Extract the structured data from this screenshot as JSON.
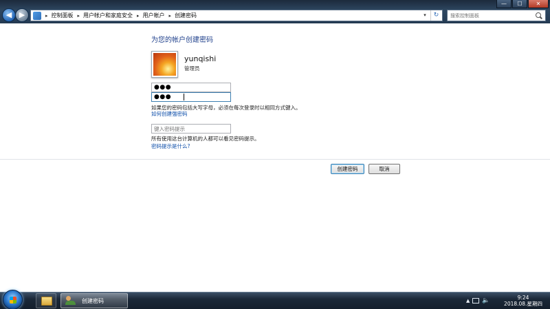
{
  "window": {
    "minimize_glyph": "—",
    "maximize_glyph": "☐",
    "close_glyph": "✕"
  },
  "nav": {
    "back_glyph": "◀",
    "forward_glyph": "▶"
  },
  "address_bar": {
    "separator": "▸",
    "breadcrumb": [
      "控制面板",
      "用户帐户和家庭安全",
      "用户帐户",
      "创建密码"
    ],
    "dropdown_glyph": "▾",
    "refresh_glyph": "↻"
  },
  "search": {
    "placeholder": "搜索控制面板"
  },
  "content": {
    "title": "为您的帐户创建密码",
    "user": {
      "name": "yunqishi",
      "role": "管理员"
    },
    "password_masked": "●●●",
    "confirm_masked": "●●●",
    "caps_warning": "如果您的密码包括大写字母，必须在每次登录时以相同方式键入。",
    "link_strong_password": "如何创建强密码",
    "hint_placeholder": "键入密码提示",
    "hint_warning": "所有使用这台计算机的人都可以看见密码提示。",
    "link_what_hint": "密码提示是什么?",
    "button_create": "创建密码",
    "button_cancel": "取消"
  },
  "taskbar": {
    "active_task": "创建密码",
    "tray_up_glyph": "▲",
    "volume_glyph": "🔈",
    "clock_time": "9:24",
    "clock_date": "2018.08.星期四"
  }
}
